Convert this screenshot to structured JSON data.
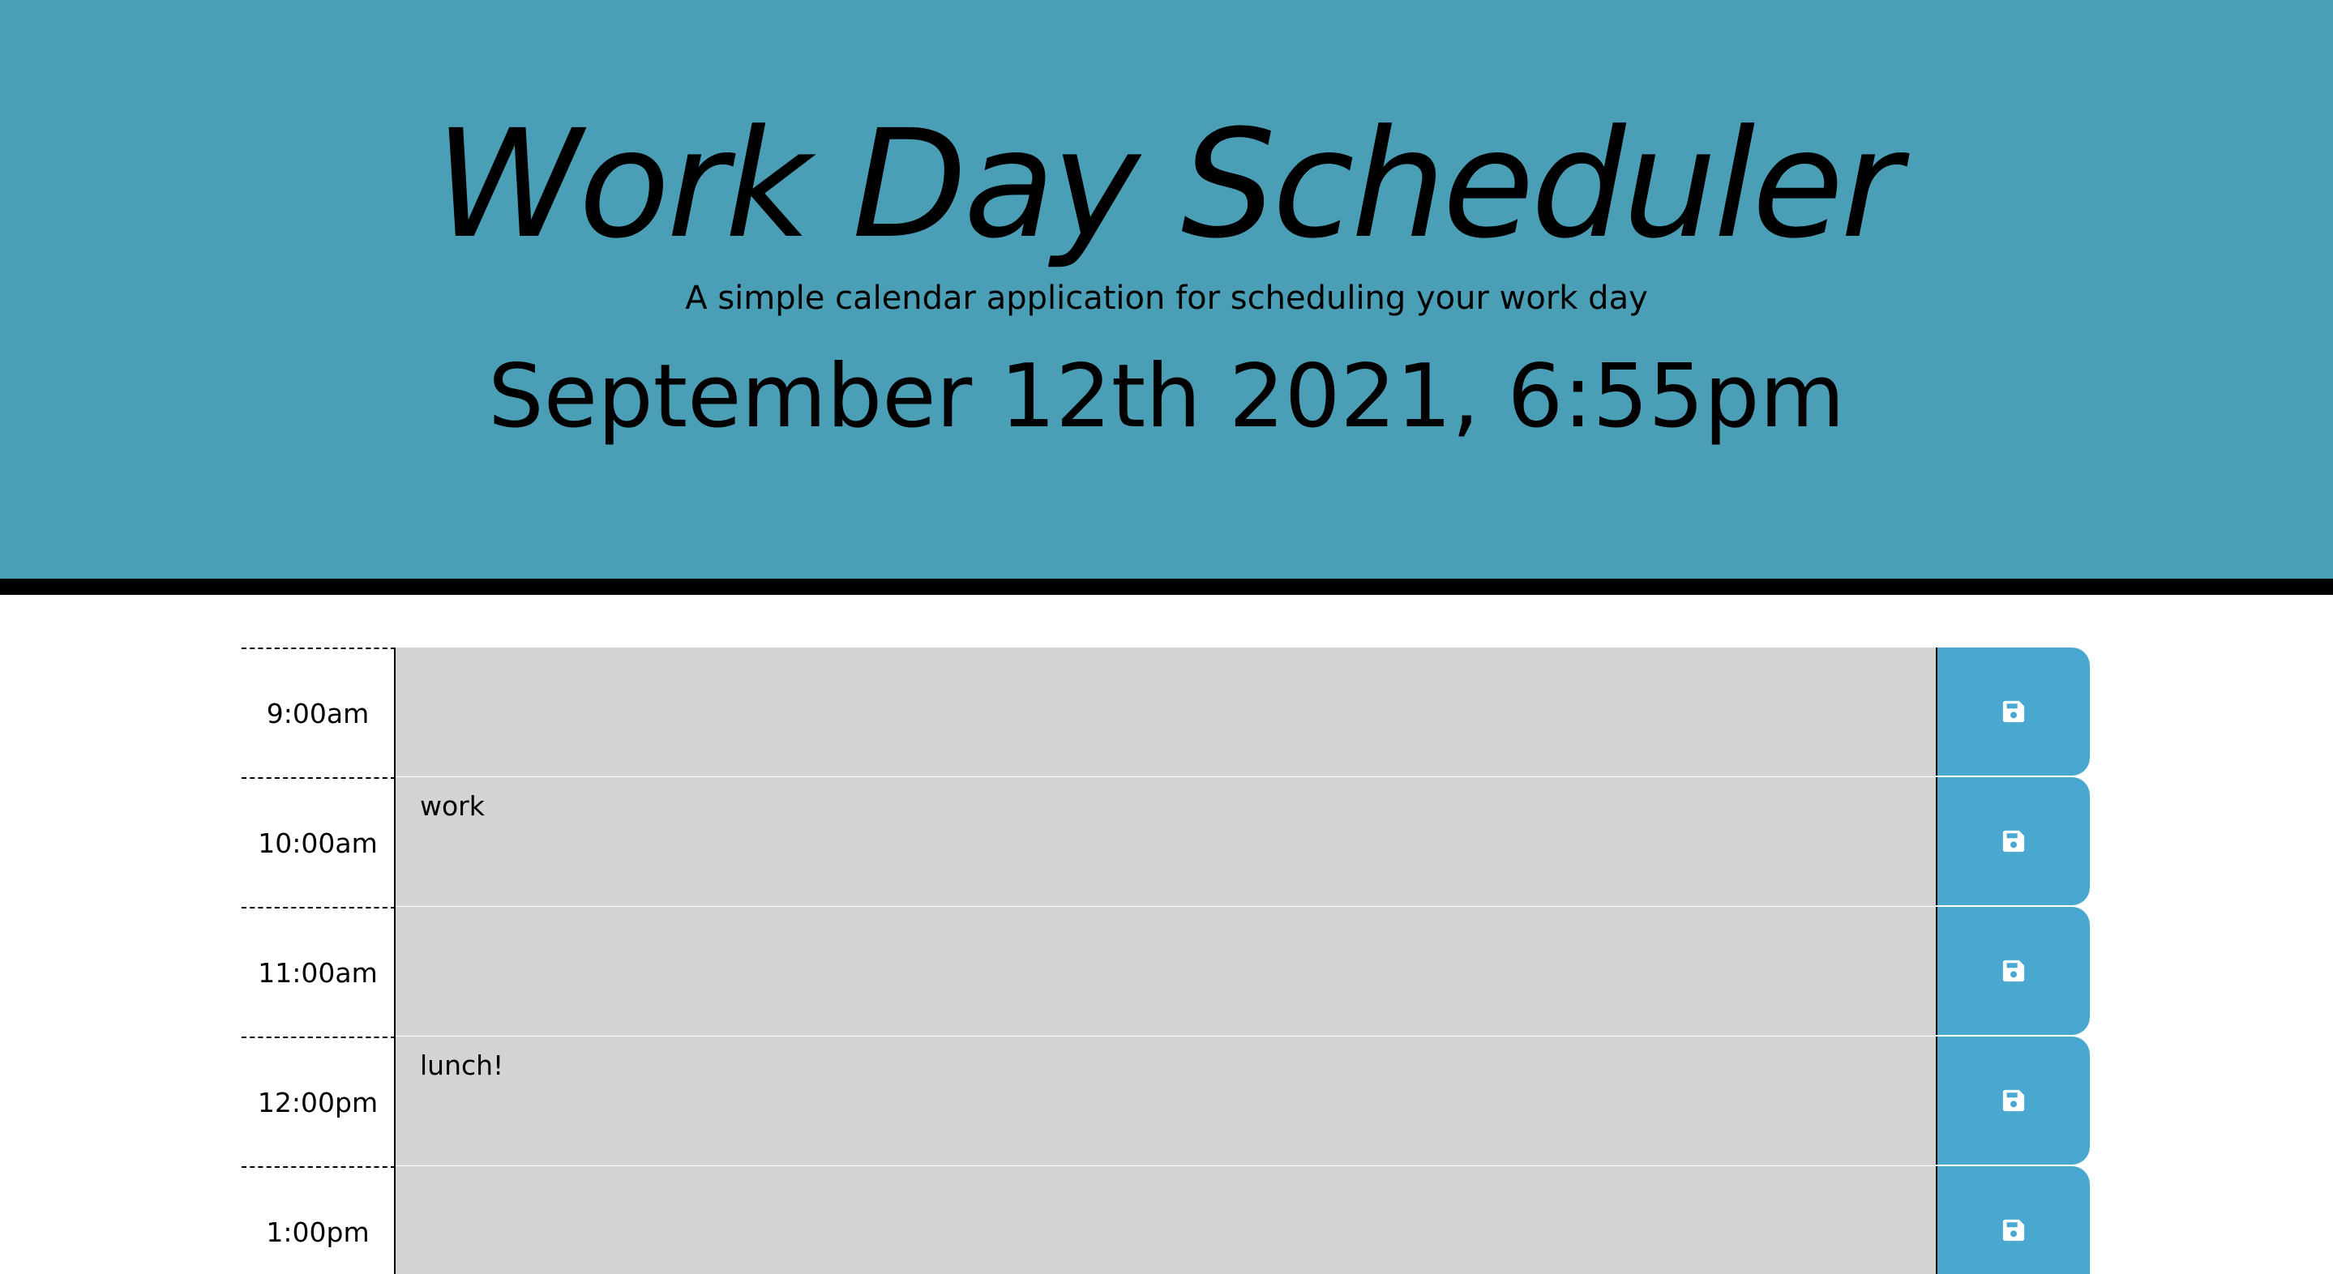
{
  "header": {
    "title": "Work Day Scheduler",
    "lead": "A simple calendar application for scheduling your work day",
    "current_day": "September 12th 2021, 6:55pm"
  },
  "colors": {
    "header_bg": "#4a9fb6",
    "past_block": "#d3d3d3",
    "save_button": "#4aa8d0"
  },
  "schedule": {
    "rows": [
      {
        "hour": "9:00am",
        "text": "",
        "save_icon": "save-icon"
      },
      {
        "hour": "10:00am",
        "text": "work",
        "save_icon": "save-icon"
      },
      {
        "hour": "11:00am",
        "text": "",
        "save_icon": "save-icon"
      },
      {
        "hour": "12:00pm",
        "text": "lunch!",
        "save_icon": "save-icon"
      },
      {
        "hour": "1:00pm",
        "text": "",
        "save_icon": "save-icon"
      }
    ]
  }
}
